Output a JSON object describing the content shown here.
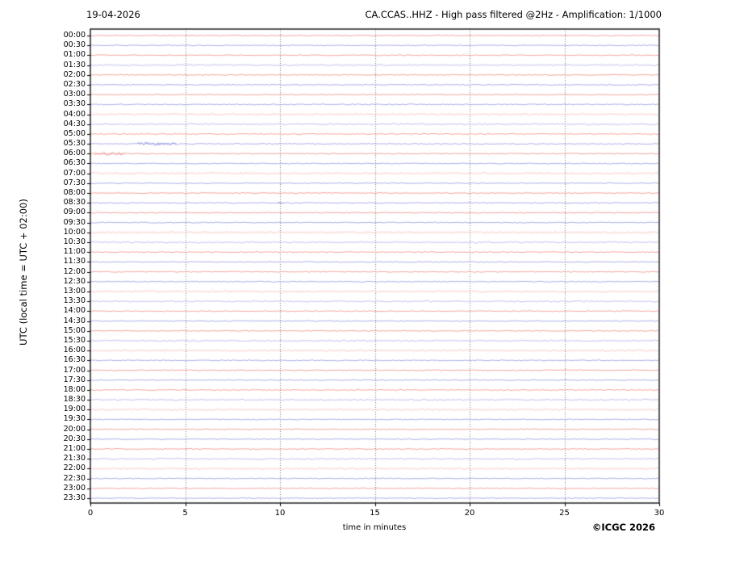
{
  "chart_data": {
    "type": "line",
    "date": "19-04-2026",
    "title": "CA.CCAS..HHZ - High pass filtered @2Hz - Amplification: 1/1000",
    "xlabel": "time in minutes",
    "ylabel": "UTC (local time = UTC + 02:00)",
    "copyright": "©ICGC 2026",
    "x_range_minutes": [
      0,
      30
    ],
    "x_ticks": [
      0,
      5,
      10,
      15,
      20,
      25,
      30
    ],
    "grid_minutes": [
      5,
      10,
      15,
      20,
      25
    ],
    "grid_style": "dotted",
    "legend": "none",
    "colors": {
      "red": "#ee8178",
      "red_fuzzy": "#f5afa9",
      "blue": "#8b8fe2",
      "blue_fuzzy": "#b0b3ec",
      "grid": "#777777",
      "axis": "#000000"
    },
    "amp_legend": "1 = quiet thin trace, 2 = slightly noisy trace, 3 = fuzzy high-noise band",
    "rows": [
      {
        "label": "00:00",
        "color": "red",
        "amp": 1
      },
      {
        "label": "00:30",
        "color": "blue",
        "amp": 1
      },
      {
        "label": "01:00",
        "color": "red",
        "amp": 1
      },
      {
        "label": "01:30",
        "color": "blue",
        "amp": 2
      },
      {
        "label": "02:00",
        "color": "red",
        "amp": 1
      },
      {
        "label": "02:30",
        "color": "blue",
        "amp": 1
      },
      {
        "label": "03:00",
        "color": "red",
        "amp": 1
      },
      {
        "label": "03:30",
        "color": "blue",
        "amp": 1
      },
      {
        "label": "04:00",
        "color": "red",
        "amp": 3
      },
      {
        "label": "04:30",
        "color": "blue",
        "amp": 2
      },
      {
        "label": "05:00",
        "color": "red",
        "amp": 1
      },
      {
        "label": "05:30",
        "color": "blue",
        "amp": 1
      },
      {
        "label": "06:00",
        "color": "red",
        "amp": 1
      },
      {
        "label": "06:30",
        "color": "blue",
        "amp": 1
      },
      {
        "label": "07:00",
        "color": "red",
        "amp": 3
      },
      {
        "label": "07:30",
        "color": "blue",
        "amp": 1
      },
      {
        "label": "08:00",
        "color": "red",
        "amp": 1
      },
      {
        "label": "08:30",
        "color": "blue",
        "amp": 1
      },
      {
        "label": "09:00",
        "color": "red",
        "amp": 1
      },
      {
        "label": "09:30",
        "color": "blue",
        "amp": 1
      },
      {
        "label": "10:00",
        "color": "red",
        "amp": 3
      },
      {
        "label": "10:30",
        "color": "blue",
        "amp": 2
      },
      {
        "label": "11:00",
        "color": "red",
        "amp": 1
      },
      {
        "label": "11:30",
        "color": "blue",
        "amp": 1
      },
      {
        "label": "12:00",
        "color": "red",
        "amp": 1
      },
      {
        "label": "12:30",
        "color": "blue",
        "amp": 1
      },
      {
        "label": "13:00",
        "color": "red",
        "amp": 3
      },
      {
        "label": "13:30",
        "color": "blue",
        "amp": 2
      },
      {
        "label": "14:00",
        "color": "red",
        "amp": 1
      },
      {
        "label": "14:30",
        "color": "blue",
        "amp": 1
      },
      {
        "label": "15:00",
        "color": "red",
        "amp": 1
      },
      {
        "label": "15:30",
        "color": "blue",
        "amp": 2
      },
      {
        "label": "16:00",
        "color": "red",
        "amp": 3
      },
      {
        "label": "16:30",
        "color": "blue",
        "amp": 1
      },
      {
        "label": "17:00",
        "color": "red",
        "amp": 1
      },
      {
        "label": "17:30",
        "color": "blue",
        "amp": 1
      },
      {
        "label": "18:00",
        "color": "red",
        "amp": 1
      },
      {
        "label": "18:30",
        "color": "blue",
        "amp": 2
      },
      {
        "label": "19:00",
        "color": "red",
        "amp": 3
      },
      {
        "label": "19:30",
        "color": "blue",
        "amp": 1
      },
      {
        "label": "20:00",
        "color": "red",
        "amp": 1
      },
      {
        "label": "20:30",
        "color": "blue",
        "amp": 1
      },
      {
        "label": "21:00",
        "color": "red",
        "amp": 1
      },
      {
        "label": "21:30",
        "color": "blue",
        "amp": 2
      },
      {
        "label": "22:00",
        "color": "red",
        "amp": 3
      },
      {
        "label": "22:30",
        "color": "blue",
        "amp": 1
      },
      {
        "label": "23:00",
        "color": "red",
        "amp": 1
      },
      {
        "label": "23:30",
        "color": "blue",
        "amp": 1
      }
    ],
    "events": [
      {
        "row": "05:30",
        "start_min": 2.5,
        "end_min": 4.6,
        "boost": 1.8
      },
      {
        "row": "06:00",
        "start_min": 0.2,
        "end_min": 1.8,
        "boost": 1.8
      },
      {
        "row": "08:30",
        "start_min": 9.9,
        "end_min": 10.2,
        "boost": 1.6
      }
    ]
  }
}
